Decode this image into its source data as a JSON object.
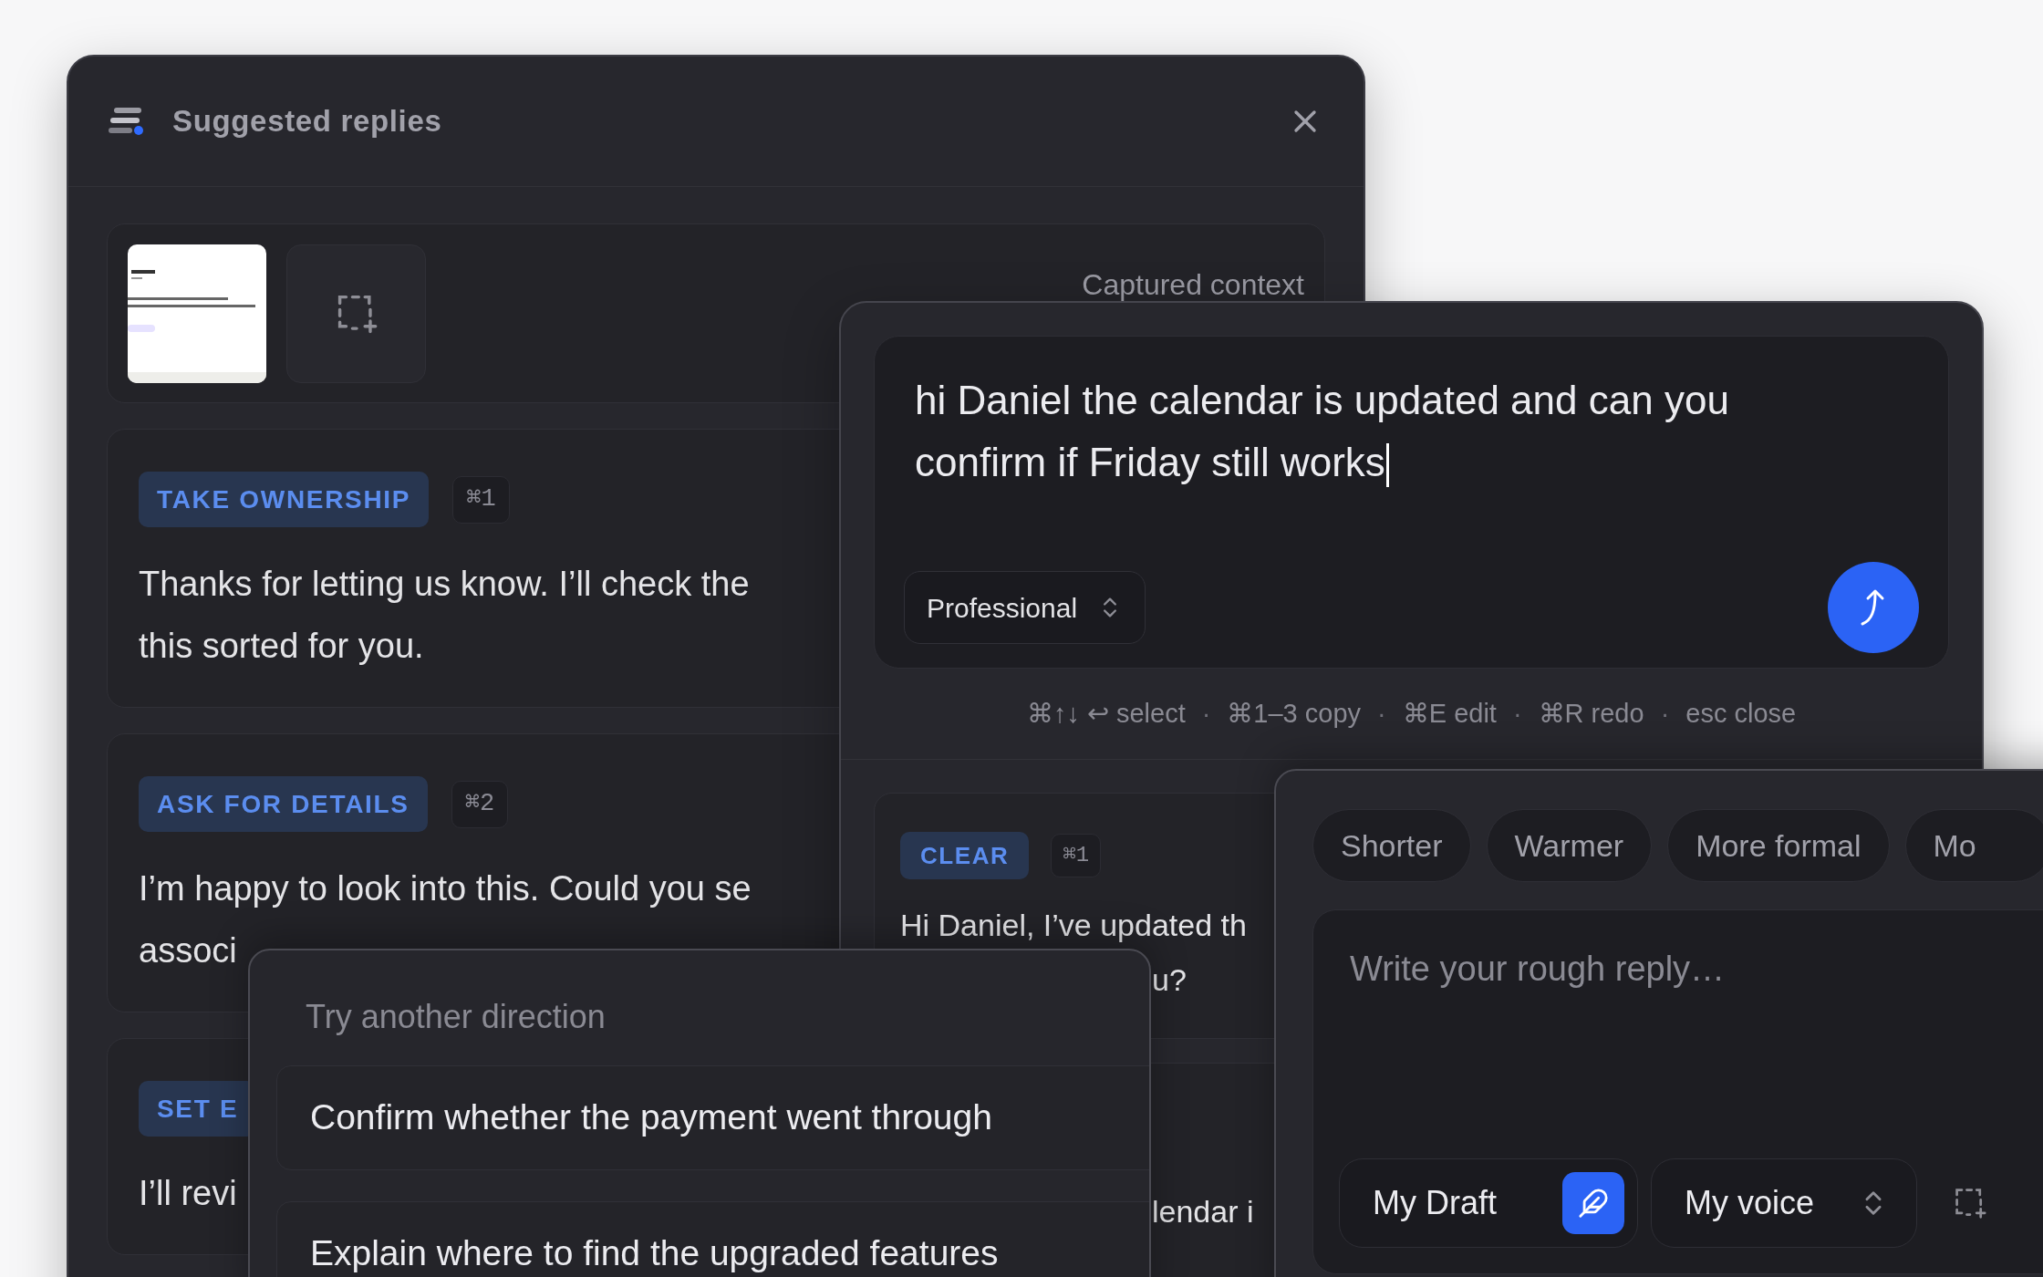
{
  "suggested_replies": {
    "title": "Suggested replies",
    "context_label": "Captured context",
    "replies": [
      {
        "label": "TAKE OWNERSHIP",
        "shortcut": "⌘1",
        "lines": [
          "Thanks for letting us know. I’ll check the",
          "this sorted for you."
        ]
      },
      {
        "label": "ASK FOR DETAILS",
        "shortcut": "⌘2",
        "lines": [
          "I’m happy to look into this. Could you se",
          "associ"
        ]
      },
      {
        "label": "SET E",
        "lines": [
          "I’ll revi"
        ]
      }
    ]
  },
  "composer": {
    "draft": "hi Daniel the calendar is updated and can you confirm if Friday still works",
    "tone": "Professional",
    "hints": [
      "⌘↑↓ ↩ select",
      "⌘1–3 copy",
      "⌘E edit",
      "⌘R redo",
      "esc close"
    ],
    "hint_separator": "·",
    "results": [
      {
        "label": "CLEAR",
        "shortcut": "⌘1",
        "lines": [
          "Hi Daniel, I’ve updated th",
          "u?"
        ]
      },
      {
        "lines": [
          "lendar i"
        ]
      }
    ]
  },
  "directions": {
    "title": "Try another direction",
    "options": [
      "Confirm whether the payment went through",
      "Explain where to find the upgraded features"
    ]
  },
  "rough_reply": {
    "chips": [
      "Shorter",
      "Warmer",
      "More formal",
      "Mo"
    ],
    "placeholder": "Write your rough reply…",
    "mode": "My Draft",
    "voice": "My voice"
  }
}
